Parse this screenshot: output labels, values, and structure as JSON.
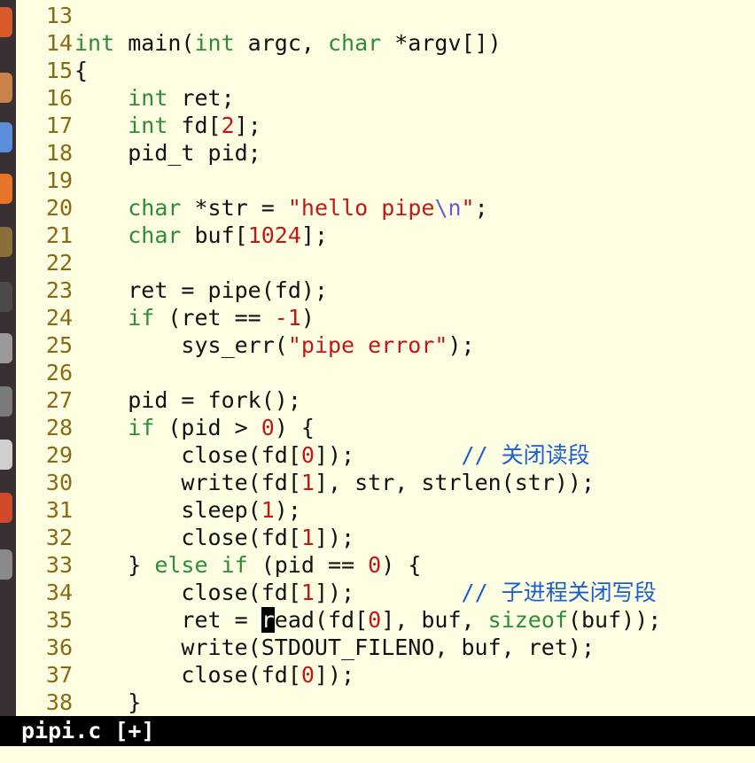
{
  "launcher": {
    "icons": [
      {
        "name": "ubuntu-dash-icon",
        "color": "#d65a2c"
      },
      {
        "name": "files-icon",
        "color": "#c8824a"
      },
      {
        "name": "chromium-icon",
        "color": "#5a8fd8"
      },
      {
        "name": "firefox-icon",
        "color": "#e8742a"
      },
      {
        "name": "software-center-icon",
        "color": "#8a6f3a"
      },
      {
        "name": "terminal-icon",
        "color": "#4a4a4a"
      },
      {
        "name": "system-settings-icon",
        "color": "#9a9a9a"
      },
      {
        "name": "workspace-icon",
        "color": "#7a7a7a"
      },
      {
        "name": "text-editor-icon",
        "color": "#cfcfcf"
      },
      {
        "name": "libreoffice-icon",
        "color": "#d04a2a"
      },
      {
        "name": "trash-icon",
        "color": "#8a8a8a"
      }
    ]
  },
  "editor": {
    "colors": {
      "background": "#fefee3",
      "line_number": "#8a6a12",
      "keyword": "#2e8b3a",
      "number": "#c01818",
      "string": "#c01818",
      "comment": "#1a5fd0"
    },
    "lines": [
      {
        "num": "13",
        "indent": "",
        "tokens": []
      },
      {
        "num": "14",
        "indent": "",
        "tokens": [
          {
            "t": "int",
            "c": "ty"
          },
          {
            "t": " main("
          },
          {
            "t": "int",
            "c": "ty"
          },
          {
            "t": " argc, "
          },
          {
            "t": "char",
            "c": "ty"
          },
          {
            "t": " *argv[])"
          }
        ]
      },
      {
        "num": "15",
        "indent": "",
        "tokens": [
          {
            "t": "{"
          }
        ]
      },
      {
        "num": "16",
        "indent": "    ",
        "tokens": [
          {
            "t": "int",
            "c": "ty"
          },
          {
            "t": " ret;"
          }
        ]
      },
      {
        "num": "17",
        "indent": "    ",
        "tokens": [
          {
            "t": "int",
            "c": "ty"
          },
          {
            "t": " fd["
          },
          {
            "t": "2",
            "c": "num"
          },
          {
            "t": "];"
          }
        ]
      },
      {
        "num": "18",
        "indent": "    ",
        "tokens": [
          {
            "t": "pid_t pid;"
          }
        ]
      },
      {
        "num": "19",
        "indent": "",
        "tokens": []
      },
      {
        "num": "20",
        "indent": "    ",
        "tokens": [
          {
            "t": "char",
            "c": "ty"
          },
          {
            "t": " *str = "
          },
          {
            "t": "\"hello pipe",
            "c": "str"
          },
          {
            "t": "\\n",
            "c": "esc"
          },
          {
            "t": "\"",
            "c": "str"
          },
          {
            "t": ";"
          }
        ]
      },
      {
        "num": "21",
        "indent": "    ",
        "tokens": [
          {
            "t": "char",
            "c": "ty"
          },
          {
            "t": " buf["
          },
          {
            "t": "1024",
            "c": "num"
          },
          {
            "t": "];"
          }
        ]
      },
      {
        "num": "22",
        "indent": "",
        "tokens": []
      },
      {
        "num": "23",
        "indent": "    ",
        "tokens": [
          {
            "t": "ret = pipe(fd);"
          }
        ]
      },
      {
        "num": "24",
        "indent": "    ",
        "tokens": [
          {
            "t": "if",
            "c": "kw"
          },
          {
            "t": " (ret == "
          },
          {
            "t": "-1",
            "c": "num"
          },
          {
            "t": ")"
          }
        ]
      },
      {
        "num": "25",
        "indent": "        ",
        "tokens": [
          {
            "t": "sys_err("
          },
          {
            "t": "\"pipe error\"",
            "c": "str"
          },
          {
            "t": ");"
          }
        ]
      },
      {
        "num": "26",
        "indent": "",
        "tokens": []
      },
      {
        "num": "27",
        "indent": "    ",
        "tokens": [
          {
            "t": "pid = fork();"
          }
        ]
      },
      {
        "num": "28",
        "indent": "    ",
        "tokens": [
          {
            "t": "if",
            "c": "kw"
          },
          {
            "t": " (pid > "
          },
          {
            "t": "0",
            "c": "num"
          },
          {
            "t": ") {"
          }
        ]
      },
      {
        "num": "29",
        "indent": "        ",
        "tokens": [
          {
            "t": "close(fd["
          },
          {
            "t": "0",
            "c": "num"
          },
          {
            "t": "]);        "
          },
          {
            "t": "// 关闭读段",
            "c": "cmt"
          }
        ]
      },
      {
        "num": "30",
        "indent": "        ",
        "tokens": [
          {
            "t": "write(fd["
          },
          {
            "t": "1",
            "c": "num"
          },
          {
            "t": "], str, strlen(str));"
          }
        ]
      },
      {
        "num": "31",
        "indent": "        ",
        "tokens": [
          {
            "t": "sleep("
          },
          {
            "t": "1",
            "c": "num"
          },
          {
            "t": ");"
          }
        ]
      },
      {
        "num": "32",
        "indent": "        ",
        "tokens": [
          {
            "t": "close(fd["
          },
          {
            "t": "1",
            "c": "num"
          },
          {
            "t": "]);"
          }
        ]
      },
      {
        "num": "33",
        "indent": "    ",
        "tokens": [
          {
            "t": "} "
          },
          {
            "t": "else if",
            "c": "kw"
          },
          {
            "t": " (pid == "
          },
          {
            "t": "0",
            "c": "num"
          },
          {
            "t": ") {"
          }
        ]
      },
      {
        "num": "34",
        "indent": "        ",
        "tokens": [
          {
            "t": "close(fd["
          },
          {
            "t": "1",
            "c": "num"
          },
          {
            "t": "]);        "
          },
          {
            "t": "// 子进程关闭写段",
            "c": "cmt"
          }
        ]
      },
      {
        "num": "35",
        "indent": "        ",
        "tokens": [
          {
            "t": "ret = "
          },
          {
            "t": "r",
            "c": "cursor"
          },
          {
            "t": "ead(fd["
          },
          {
            "t": "0",
            "c": "num"
          },
          {
            "t": "], buf, "
          },
          {
            "t": "sizeof",
            "c": "kw"
          },
          {
            "t": "(buf));"
          }
        ]
      },
      {
        "num": "36",
        "indent": "        ",
        "tokens": [
          {
            "t": "write(STDOUT_FILENO, buf, ret);"
          }
        ]
      },
      {
        "num": "37",
        "indent": "        ",
        "tokens": [
          {
            "t": "close(fd["
          },
          {
            "t": "0",
            "c": "num"
          },
          {
            "t": "]);"
          }
        ]
      },
      {
        "num": "38",
        "indent": "    ",
        "tokens": [
          {
            "t": "}"
          }
        ]
      }
    ]
  },
  "statusbar": {
    "filename": "pipi.c",
    "modified": "[+]"
  }
}
